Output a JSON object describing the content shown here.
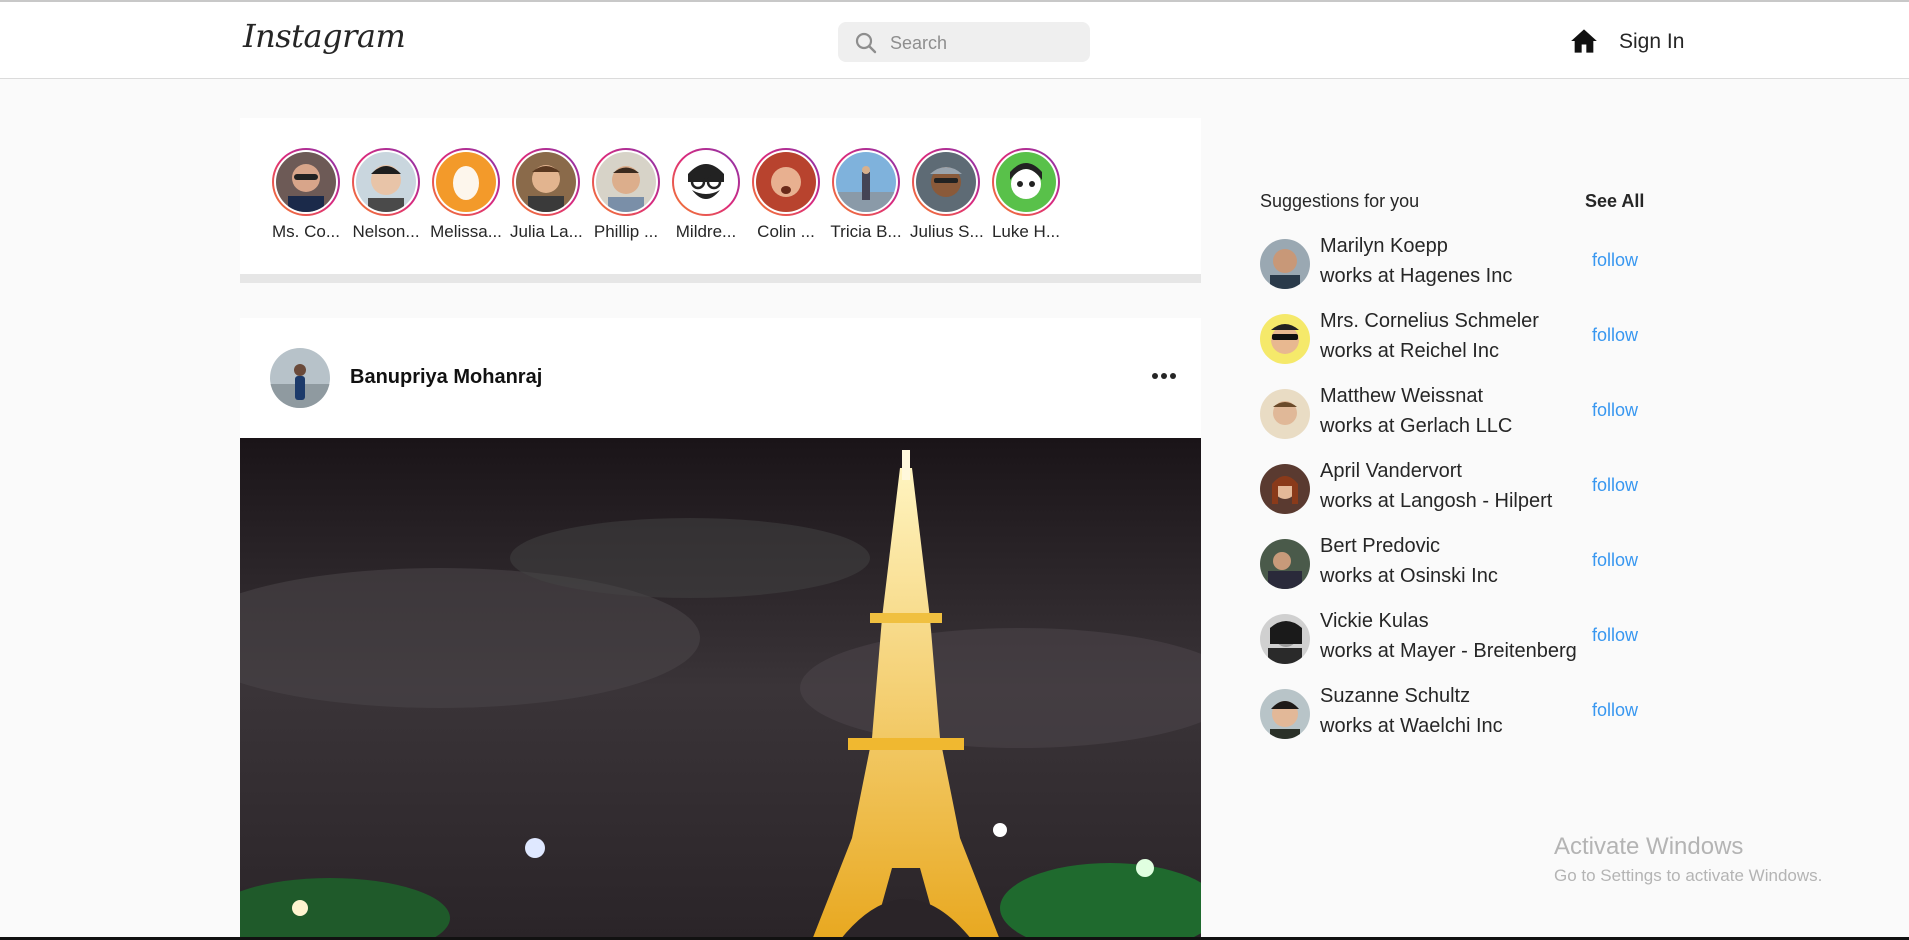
{
  "header": {
    "logo": "Instagram",
    "search_placeholder": "Search",
    "sign_in": "Sign In"
  },
  "stories": [
    {
      "label": "Ms. Co..."
    },
    {
      "label": "Nelson..."
    },
    {
      "label": "Melissa..."
    },
    {
      "label": "Julia La..."
    },
    {
      "label": "Phillip ..."
    },
    {
      "label": "Mildre..."
    },
    {
      "label": "Colin ..."
    },
    {
      "label": "Tricia B..."
    },
    {
      "label": "Julius S..."
    },
    {
      "label": "Luke H..."
    }
  ],
  "post": {
    "username": "Banupriya Mohanraj"
  },
  "suggestions": {
    "title": "Suggestions for you",
    "see_all": "See All",
    "items": [
      {
        "name": "Marilyn Koepp",
        "work": "works at Hagenes Inc",
        "action": "follow"
      },
      {
        "name": "Mrs. Cornelius Schmeler",
        "work": "works at Reichel Inc",
        "action": "follow"
      },
      {
        "name": "Matthew Weissnat",
        "work": "works at Gerlach LLC",
        "action": "follow"
      },
      {
        "name": "April Vandervort",
        "work": "works at Langosh - Hilpert",
        "action": "follow"
      },
      {
        "name": "Bert Predovic",
        "work": "works at Osinski Inc",
        "action": "follow"
      },
      {
        "name": "Vickie Kulas",
        "work": "works at Mayer - Breitenberg",
        "action": "follow"
      },
      {
        "name": "Suzanne Schultz",
        "work": "works at Waelchi Inc",
        "action": "follow"
      }
    ]
  },
  "watermark": {
    "line1": "Activate Windows",
    "line2": "Go to Settings to activate Windows."
  },
  "colors": {
    "link_blue": "#3897f0",
    "story_ring": "#dd2a7b",
    "background": "#fafafa"
  }
}
